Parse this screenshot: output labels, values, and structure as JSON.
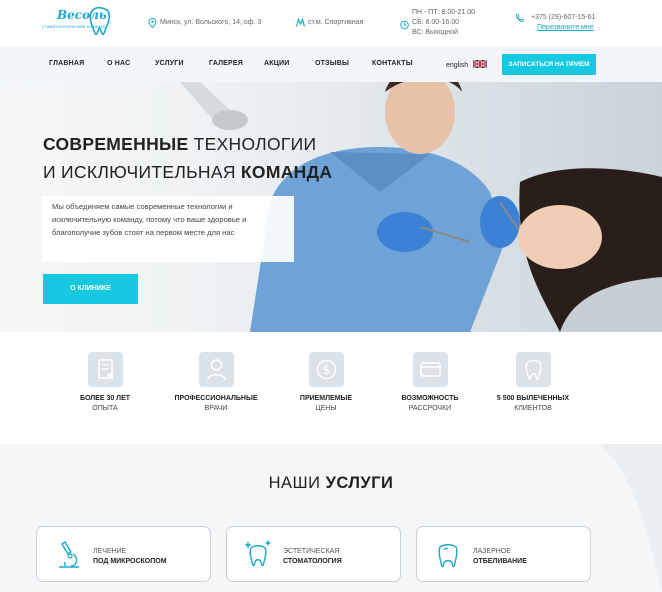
{
  "logo": {
    "name": "Весоль",
    "tagline": "стоматологическая клиника"
  },
  "contacts": {
    "address": "Минск, ул. Вольского, 14, оф. 3",
    "metro": "ст.м. Спортивная",
    "hours": [
      "ПН - ПТ: 8.00-21.00",
      "СБ: 8.00-16.00",
      "ВС: Выходной"
    ],
    "phone": "+375 (29)-607-15-61",
    "callback": "Перезвоните мне"
  },
  "nav": {
    "items": [
      "ГЛАВНАЯ",
      "О НАС",
      "УСЛУГИ",
      "ГАЛЕРЕЯ",
      "АКЦИИ",
      "ОТЗЫВЫ",
      "КОНТАКТЫ"
    ],
    "language": "english",
    "cta": "ЗАПИСАТЬСЯ НА ПРИЕМ"
  },
  "hero": {
    "title_line1_bold": "СОВРЕМЕННЫЕ",
    "title_line1_rest": " ТЕХНОЛОГИИ",
    "title_line2_rest": "И ИСКЛЮЧИТЕЛЬНАЯ ",
    "title_line2_bold": "КОМАНДА",
    "description": "Мы объединяем самые современные технологии и исключительную команду, потому что ваше здоровье и благополучие зубов стоят на первом месте для нас",
    "button": "О КЛИНИКЕ"
  },
  "features": [
    {
      "title": "БОЛЕЕ 30 ЛЕТ",
      "subtitle": "ОПЫТА",
      "icon": "certificate-icon"
    },
    {
      "title": "ПРОФЕССИОНАЛЬНЫЕ",
      "subtitle": "ВРАЧИ",
      "icon": "doctor-icon"
    },
    {
      "title": "ПРИЕМЛЕМЫЕ",
      "subtitle": "ЦЕНЫ",
      "icon": "dollar-icon"
    },
    {
      "title": "ВОЗМОЖНОСТЬ",
      "subtitle": "РАССРОЧКИ",
      "icon": "card-icon"
    },
    {
      "title": "5 500 ВЫЛЕЧЕННЫХ",
      "subtitle": "КЛИЕНТОВ",
      "icon": "tooth-icon"
    }
  ],
  "services": {
    "title_light": "НАШИ ",
    "title_bold": "УСЛУГИ",
    "cards": [
      {
        "line1": "ЛЕЧЕНИЕ",
        "line2": "ПОД МИКРОСКОПОМ",
        "icon": "microscope-icon"
      },
      {
        "line1": "ЭСТЕТИЧЕСКАЯ",
        "line2": "СТОМАТОЛОГИЯ",
        "icon": "sparkle-tooth-icon"
      },
      {
        "line1": "ЛАЗЕРНОЕ",
        "line2": "ОТБЕЛИВАНИЕ",
        "icon": "whitening-tooth-icon"
      }
    ]
  },
  "colors": {
    "accent": "#16c8e0",
    "brand": "#1ba9c9"
  }
}
